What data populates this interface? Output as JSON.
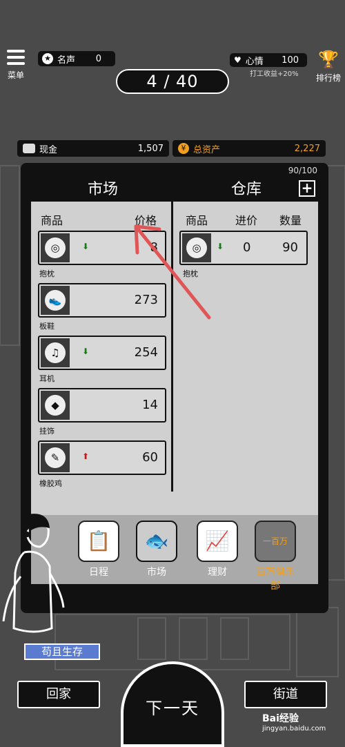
{
  "header": {
    "menu_label": "菜单",
    "fame_label": "名声",
    "fame_value": "0",
    "day_progress": "4 / 40",
    "mood_label": "心情",
    "mood_value": "100",
    "mood_sub": "打工收益+20%",
    "rank_label": "排行榜"
  },
  "finance": {
    "cash_label": "现金",
    "cash_value": "1,507",
    "assets_label": "总资产",
    "assets_value": "2,227"
  },
  "panel": {
    "capacity": "90/100",
    "market_tab": "市场",
    "warehouse_tab": "仓库",
    "market_headers": {
      "item": "商品",
      "price": "价格"
    },
    "warehouse_headers": {
      "item": "商品",
      "cost": "进价",
      "qty": "数量"
    }
  },
  "market_items": [
    {
      "name": "抱枕",
      "price": "8",
      "trend": "down",
      "icon": "pillow-icon"
    },
    {
      "name": "板鞋",
      "price": "273",
      "trend": "none",
      "icon": "sneaker-icon"
    },
    {
      "name": "耳机",
      "price": "254",
      "trend": "down",
      "icon": "earphone-icon"
    },
    {
      "name": "挂饰",
      "price": "14",
      "trend": "none",
      "icon": "charm-icon"
    },
    {
      "name": "橡胶鸡",
      "price": "60",
      "trend": "up",
      "icon": "rubber-chicken-icon"
    }
  ],
  "warehouse_items": [
    {
      "name": "抱枕",
      "cost": "0",
      "qty": "90",
      "trend": "down",
      "icon": "pillow-icon"
    }
  ],
  "nav": {
    "schedule": "日程",
    "market": "市场",
    "finance": "理财",
    "club": "百万俱乐部",
    "club_badge": "一百万"
  },
  "footer": {
    "survive_label": "苟且生存",
    "go_home": "回家",
    "next_day": "下一天",
    "street": "街道"
  },
  "watermark": {
    "brand": "Bai经验",
    "url": "jingyan.baidu.com"
  },
  "colors": {
    "accent_gold": "#f0a020",
    "trend_down": "#1a7a1a",
    "trend_up": "#c01a1a",
    "annotation_arrow": "#e05555"
  }
}
